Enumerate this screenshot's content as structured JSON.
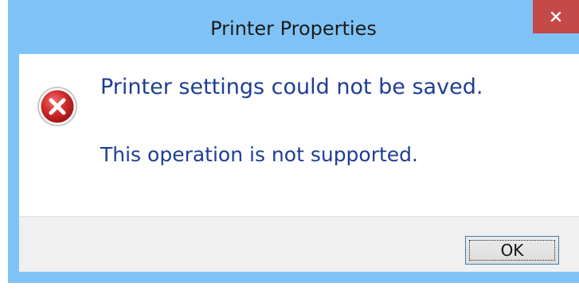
{
  "window": {
    "title": "Printer Properties",
    "close_icon": "close-icon",
    "titlebar_color": "#7fc3f6",
    "close_button_color": "#c44a4a"
  },
  "message": {
    "icon": "error-icon",
    "primary": "Printer settings could not be saved.",
    "secondary": "This operation is not supported.",
    "text_color": "#1e3e94"
  },
  "footer": {
    "ok_label": "OK"
  }
}
